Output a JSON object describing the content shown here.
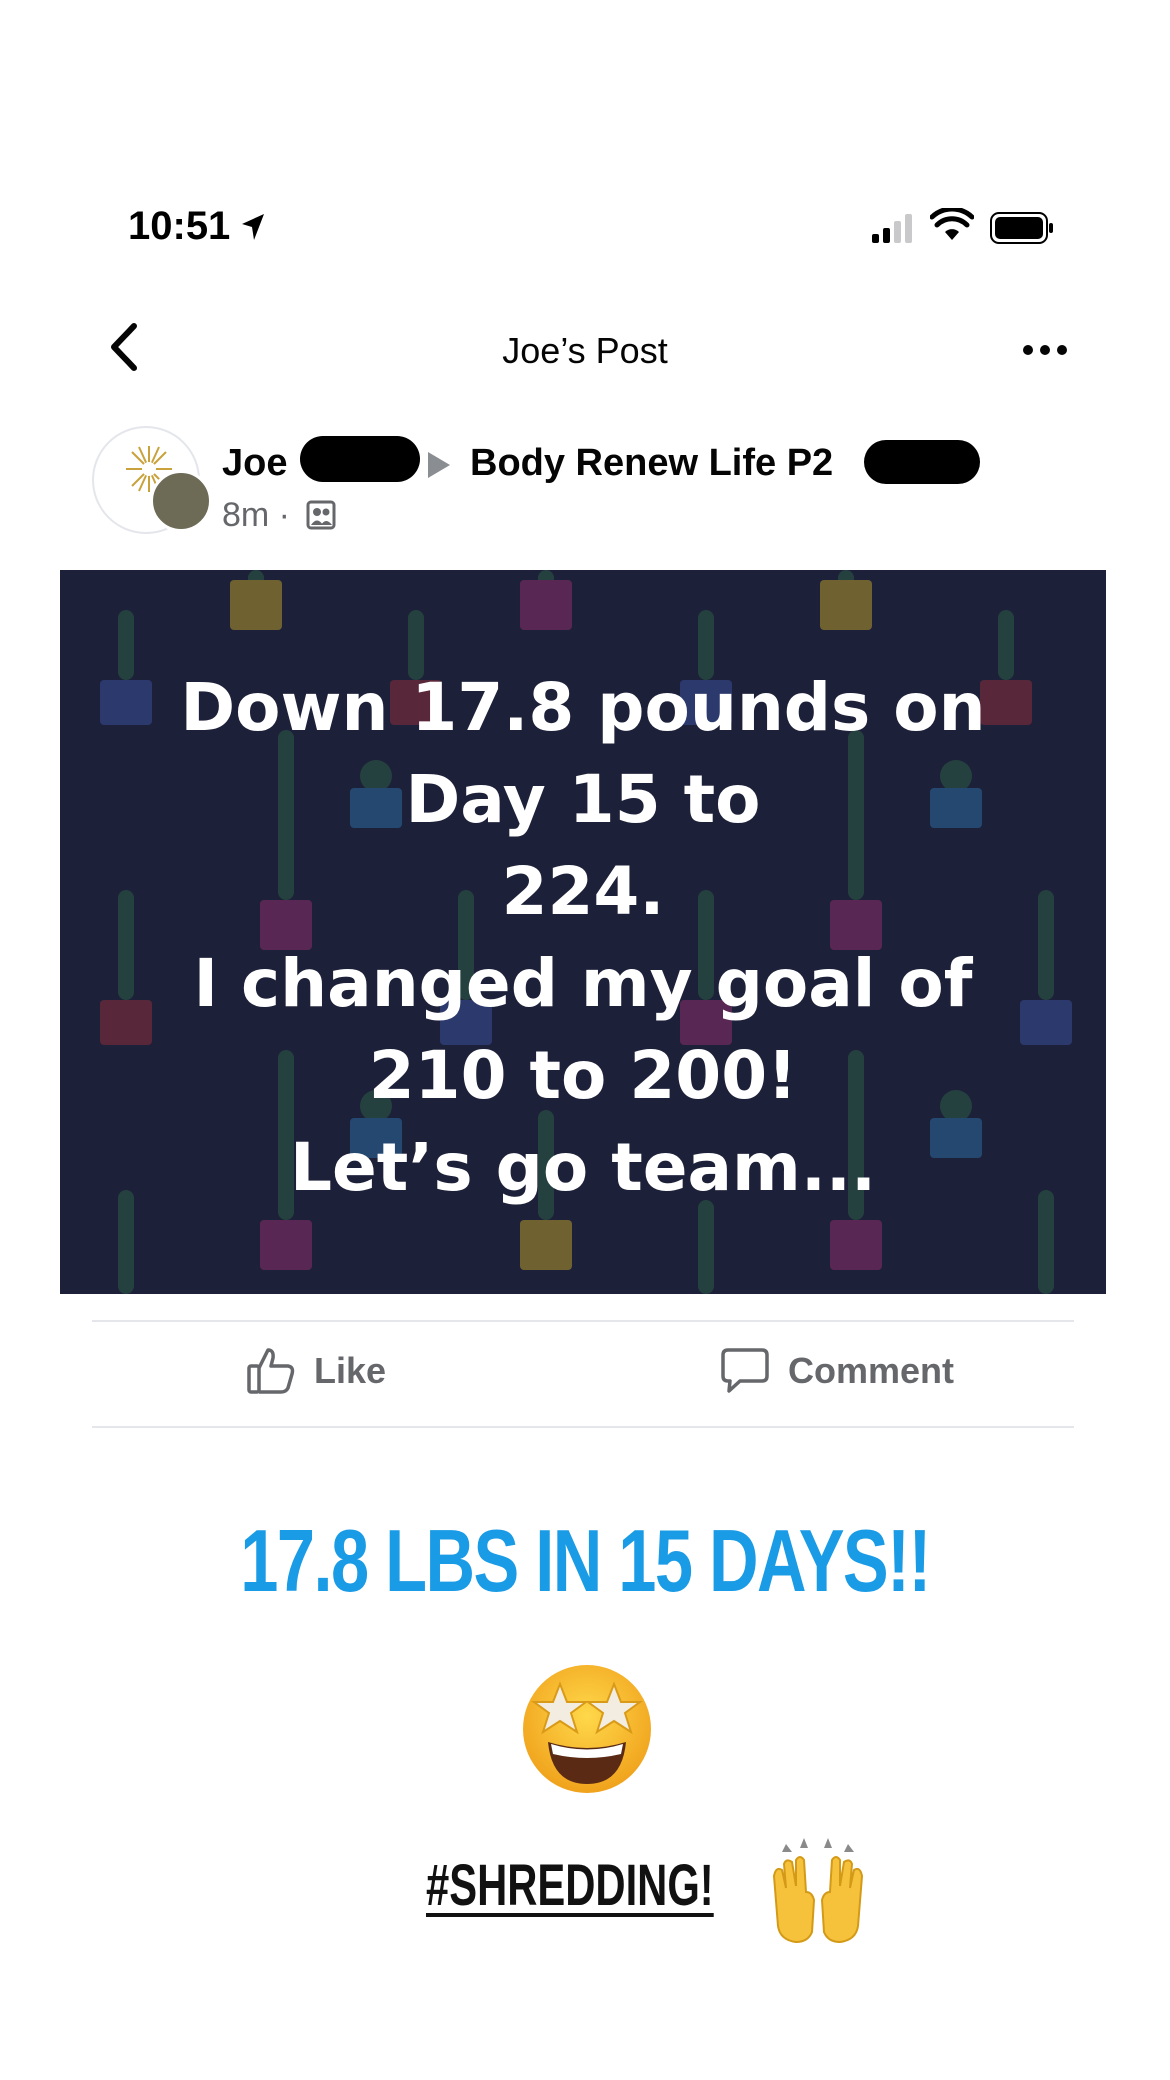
{
  "status_bar": {
    "time": "10:51"
  },
  "nav": {
    "title": "Joe’s Post"
  },
  "post": {
    "author": "Joe",
    "group": "Body Renew Life P2",
    "meta": "8m ·",
    "image_text_lines": [
      "Down 17.8 pounds on",
      "Day 15 to",
      "224.",
      "I changed my goal of",
      "210 to 200!",
      "Let’s go team..."
    ],
    "colors": {
      "image_background": "#1d2039",
      "meta_gray": "#65676b"
    }
  },
  "actions": {
    "like_label": "Like",
    "comment_label": "Comment"
  },
  "story": {
    "headline": "17.8 LBS IN 15 DAYS!!",
    "hashtag": "#SHREDDING!",
    "headline_color": "#1a9be6"
  }
}
